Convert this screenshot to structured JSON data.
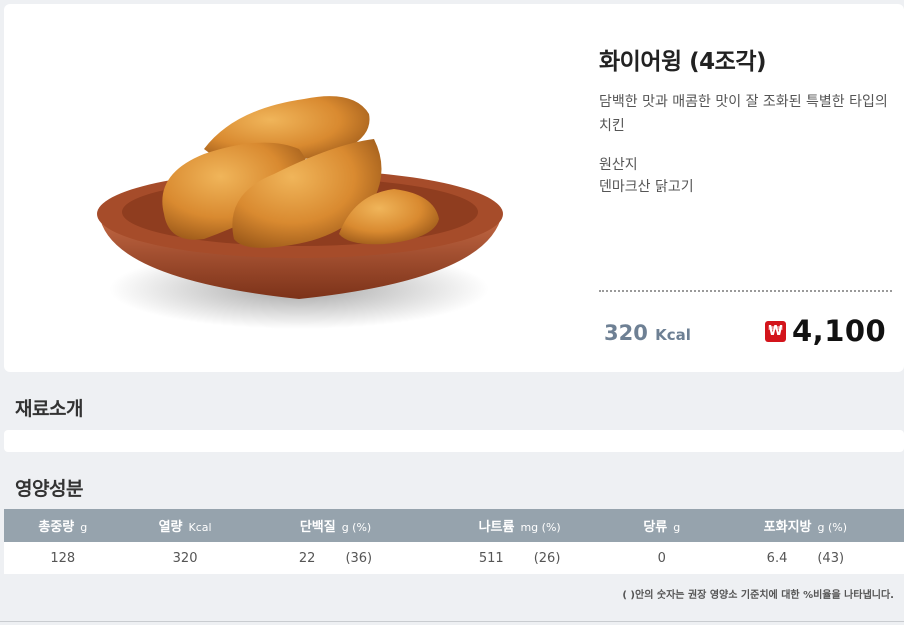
{
  "product": {
    "name": "화이어윙 (4조각)",
    "description": "담백한 맛과 매콤한 맛이 잘 조화된 특별한 타입의 치킨",
    "origin_label": "원산지",
    "origin_value": "덴마크산 닭고기",
    "kcal_value": "320",
    "kcal_unit": "Kcal",
    "currency_icon": "won-icon",
    "currency_symbol": "₩",
    "price": "4,100",
    "image": "fried-chicken-wings-plate"
  },
  "sections": {
    "ingredients_title": "재료소개",
    "nutrition_title": "영양성분"
  },
  "nutrition": {
    "headers": [
      {
        "label": "총중량",
        "unit": "g"
      },
      {
        "label": "열량",
        "unit": "Kcal"
      },
      {
        "label": "단백질",
        "unit": "g (%)"
      },
      {
        "label": "나트륨",
        "unit": "mg (%)"
      },
      {
        "label": "당류",
        "unit": "g"
      },
      {
        "label": "포화지방",
        "unit": "g (%)"
      }
    ],
    "values": [
      {
        "value": "128",
        "pct": ""
      },
      {
        "value": "320",
        "pct": ""
      },
      {
        "value": "22",
        "pct": "(36)"
      },
      {
        "value": "511",
        "pct": "(26)"
      },
      {
        "value": "0",
        "pct": ""
      },
      {
        "value": "6.4",
        "pct": "(43)"
      }
    ],
    "footnote": "( )안의 숫자는 권장 영양소 기준치에 대한 %비율을 나타냅니다."
  },
  "colors": {
    "price_icon": "#d3141b",
    "kcal": "#6e8094",
    "table_header": "#96a3ad"
  }
}
